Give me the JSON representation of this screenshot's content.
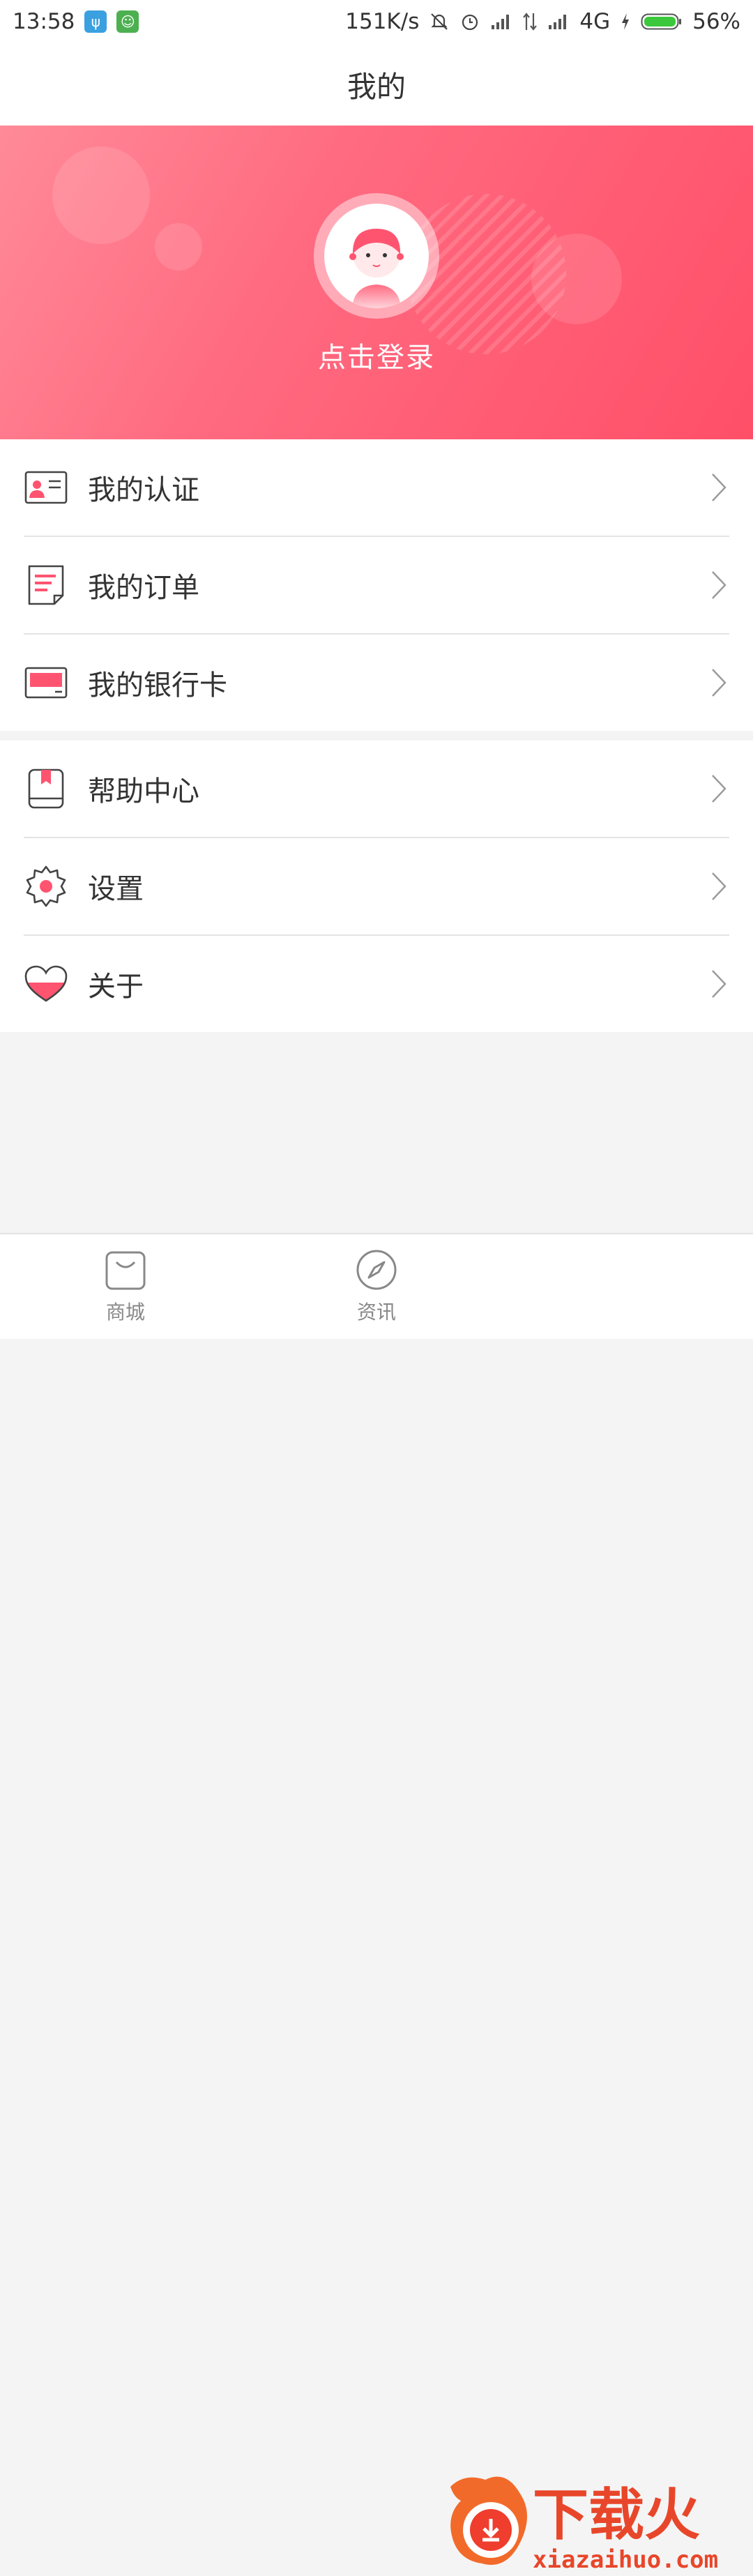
{
  "status_bar": {
    "time": "13:58",
    "net_speed": "151K/s",
    "network": "4G",
    "battery": "56%",
    "battery_level": 0.56
  },
  "header": {
    "title": "我的"
  },
  "profile": {
    "login_label": "点击登录"
  },
  "menu_groups": [
    [
      {
        "label": "我的认证",
        "icon": "id-card-icon"
      },
      {
        "label": "我的订单",
        "icon": "order-list-icon"
      },
      {
        "label": "我的银行卡",
        "icon": "bank-card-icon"
      }
    ],
    [
      {
        "label": "帮助中心",
        "icon": "help-book-icon"
      },
      {
        "label": "设置",
        "icon": "settings-gear-icon"
      },
      {
        "label": "关于",
        "icon": "heart-icon"
      }
    ]
  ],
  "tabbar": {
    "tabs": [
      {
        "label": "商城",
        "icon": "shopping-bag-icon"
      },
      {
        "label": "资讯",
        "icon": "compass-icon"
      }
    ]
  },
  "watermark": {
    "text": "下载火",
    "url_text": "xiazaihuo.com"
  },
  "colors": {
    "accent": "#ff5470",
    "hero_start": "#ff8a98",
    "hero_end": "#ff4f68"
  }
}
